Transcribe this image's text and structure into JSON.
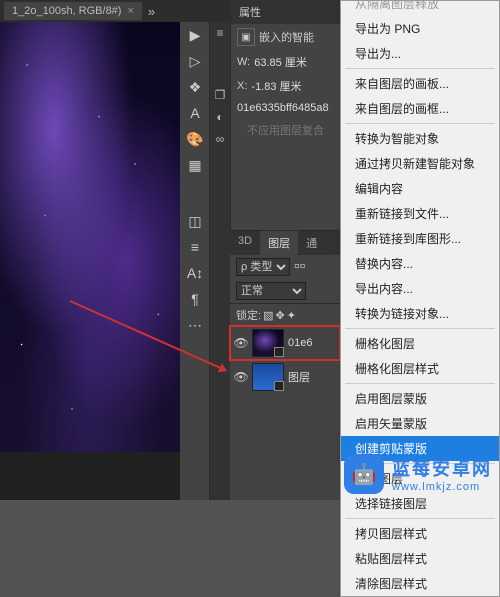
{
  "tab": {
    "title": "1_2o_100sh, RGB/8#)",
    "close": "×",
    "caret": "»"
  },
  "properties": {
    "header": "属性",
    "embedded": "嵌入的智能",
    "w_label": "W:",
    "w_value": "63.85 厘米",
    "x_label": "X:",
    "x_value": "-1.83 厘米",
    "hash": "01e6335bff6485a8",
    "unavailable": "不应用图层复合"
  },
  "layers_panel": {
    "tab_3d": "3D",
    "tab_layers": "图层",
    "tab_channels": "通",
    "kind_label": "ρ 类型",
    "blend_mode": "正常",
    "lock_label": "锁定:",
    "layer1_name": "01e6",
    "layer2_name": "图层"
  },
  "context_menu": {
    "items": [
      "导出为 PNG",
      "导出为...",
      "-",
      "来自图层的画板...",
      "来自图层的画框...",
      "-",
      "转换为智能对象",
      "通过拷贝新建智能对象",
      "编辑内容",
      "重新链接到文件...",
      "重新链接到库图形...",
      "替换内容...",
      "导出内容...",
      "转换为链接对象...",
      "-",
      "栅格化图层",
      "栅格化图层样式",
      "-",
      "启用图层蒙版",
      "启用矢量蒙版",
      "创建剪贴蒙版",
      "-",
      "链接图层",
      "选择链接图层",
      "-",
      "拷贝图层样式",
      "粘贴图层样式",
      "清除图层样式"
    ],
    "highlighted_index": 20,
    "cutoff": "从隔离图层释放"
  },
  "watermark": {
    "name": "蓝莓安卓网",
    "url": "www.lmkjz.com"
  }
}
